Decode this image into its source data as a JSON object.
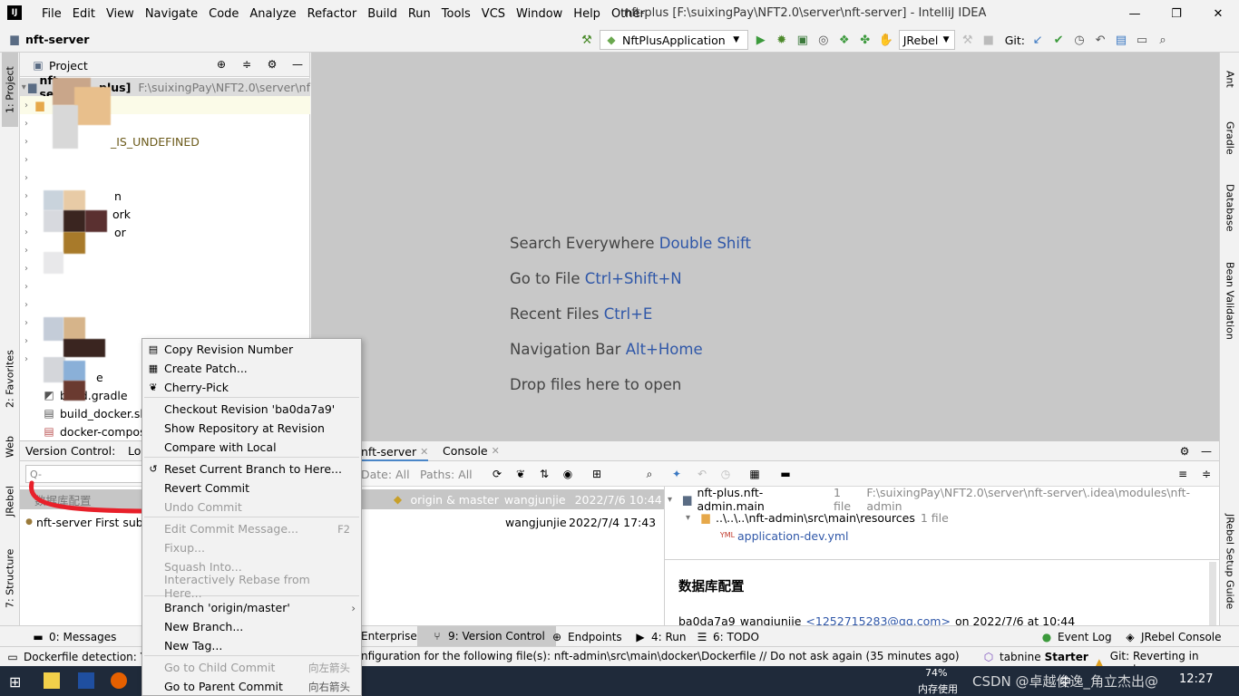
{
  "app": {
    "title": "nft-plus [F:\\suixingPay\\NFT2.0\\server\\nft-server] - IntelliJ IDEA",
    "logo": "IJ",
    "menu": [
      "File",
      "Edit",
      "View",
      "Navigate",
      "Code",
      "Analyze",
      "Refactor",
      "Build",
      "Run",
      "Tools",
      "VCS",
      "Window",
      "Help",
      "Other"
    ],
    "window_controls": [
      "—",
      "❐",
      "✕"
    ]
  },
  "navbar": {
    "breadcrumb": "nft-server",
    "run_config": "NftPlusApplication",
    "jrebel": "JRebel",
    "git_label": "Git:"
  },
  "left_stripe": {
    "project": "1: Project",
    "favorites": "2: Favorites",
    "web": "Web",
    "jrebel": "JRebel",
    "structure": "7: Structure"
  },
  "right_stripe": {
    "ant": "Ant",
    "gradle": "Gradle",
    "database": "Database",
    "bean": "Bean Validation",
    "jrebel_guide": "JRebel Setup Guide"
  },
  "project": {
    "header": "Project",
    "root_name": "nft-se",
    "root_badge": "plus]",
    "root_path": "F:\\suixingPay\\NFT2.0\\server\\nf",
    "items": [
      {
        "text": "_IS_UNDEFINED"
      },
      {
        "text": "n"
      },
      {
        "text": "ork"
      },
      {
        "text": "or"
      },
      {
        "text": "e"
      },
      {
        "text": "build.gradle"
      },
      {
        "text": "build_docker.sh"
      },
      {
        "text": "docker-compos"
      }
    ]
  },
  "editor": {
    "hints": [
      {
        "label": "Search Everywhere",
        "key": "Double Shift"
      },
      {
        "label": "Go to File",
        "key": "Ctrl+Shift+N"
      },
      {
        "label": "Recent Files",
        "key": "Ctrl+E"
      },
      {
        "label": "Navigation Bar",
        "key": "Alt+Home"
      },
      {
        "label": "Drop files here to open",
        "key": ""
      }
    ]
  },
  "version_control": {
    "header": "Version Control:",
    "header_local": "Lo",
    "tab_server": "nft-server",
    "tab_console": "Console",
    "filters": {
      "date": "Date: All",
      "paths": "Paths: All"
    },
    "search_placeholder": "Q-",
    "commits": [
      {
        "message": "数据库配置",
        "refs": "origin & master",
        "author": "wangjunjie",
        "date": "2022/7/6 10:44",
        "selected": true
      },
      {
        "message": "nft-server First subm",
        "refs": "",
        "author": "wangjunjie",
        "date": "2022/7/4 17:43",
        "selected": false
      }
    ],
    "changes": {
      "module": "nft-plus.nft-admin.main",
      "module_count": "1 file",
      "module_path": "F:\\suixingPay\\NFT2.0\\server\\nft-server\\.idea\\modules\\nft-admin",
      "folder": "..\\..\\..\\nft-admin\\src\\main\\resources",
      "folder_count": "1 file",
      "file": "application-dev.yml"
    },
    "detail": {
      "title": "数据库配置",
      "hash": "ba0da7a9",
      "author": "wangjunjie",
      "email": "<1252715283@qq.com>",
      "date": "on 2022/7/6 at 10:44"
    }
  },
  "context_menu": {
    "items": [
      {
        "label": "Copy Revision Number",
        "shortcut": "",
        "icon": "copy-icon",
        "disabled": false
      },
      {
        "label": "Create Patch...",
        "shortcut": "",
        "icon": "patch-icon",
        "disabled": false
      },
      {
        "label": "Cherry-Pick",
        "shortcut": "",
        "icon": "cherry-icon",
        "disabled": false
      },
      {
        "label": "Checkout Revision 'ba0da7a9'",
        "shortcut": "",
        "icon": "",
        "disabled": false
      },
      {
        "label": "Show Repository at Revision",
        "shortcut": "",
        "icon": "",
        "disabled": false
      },
      {
        "label": "Compare with Local",
        "shortcut": "",
        "icon": "",
        "disabled": false
      },
      {
        "label": "Reset Current Branch to Here...",
        "shortcut": "",
        "icon": "reset-icon",
        "disabled": false
      },
      {
        "label": "Revert Commit",
        "shortcut": "",
        "icon": "",
        "disabled": false
      },
      {
        "label": "Undo Commit",
        "shortcut": "",
        "icon": "",
        "disabled": true
      },
      {
        "label": "Edit Commit Message...",
        "shortcut": "F2",
        "icon": "",
        "disabled": true
      },
      {
        "label": "Fixup...",
        "shortcut": "",
        "icon": "",
        "disabled": true
      },
      {
        "label": "Squash Into...",
        "shortcut": "",
        "icon": "",
        "disabled": true
      },
      {
        "label": "Interactively Rebase from Here...",
        "shortcut": "",
        "icon": "",
        "disabled": true
      },
      {
        "label": "Branch 'origin/master'",
        "shortcut": "",
        "icon": "",
        "disabled": false
      },
      {
        "label": "New Branch...",
        "shortcut": "",
        "icon": "",
        "disabled": false
      },
      {
        "label": "New Tag...",
        "shortcut": "",
        "icon": "",
        "disabled": false
      },
      {
        "label": "Go to Child Commit",
        "shortcut": "向左箭头",
        "icon": "",
        "disabled": true
      },
      {
        "label": "Go to Parent Commit",
        "shortcut": "向右箭头",
        "icon": "",
        "disabled": false
      }
    ]
  },
  "bottom_tools": {
    "messages": "0: Messages",
    "enterprise": "Enterprise",
    "version_control": "9: Version Control",
    "endpoints": "Endpoints",
    "run": "4: Run",
    "todo": "6: TODO",
    "event_log": "Event Log",
    "jrebel_console": "JRebel Console"
  },
  "status": {
    "left": "Dockerfile detection: Y",
    "middle": "nfiguration for the following file(s): nft-admin\\src\\main\\docker\\Dockerfile // Do not ask again (35 minutes ago)",
    "tabnine": "tabnine",
    "tabnine_plan": "Starter",
    "git": "Git: Reverting in master"
  },
  "taskbar": {
    "memory_pct": "74%",
    "memory_label": "内存使用",
    "watermark": "CSDN @卓越俊逸_角立杰出@",
    "tray_char": "中",
    "clock": "12:27"
  },
  "colors": {
    "accent": "#2f57a8",
    "annotation": "#e8202a",
    "selected_row": "#c6c6c6"
  }
}
